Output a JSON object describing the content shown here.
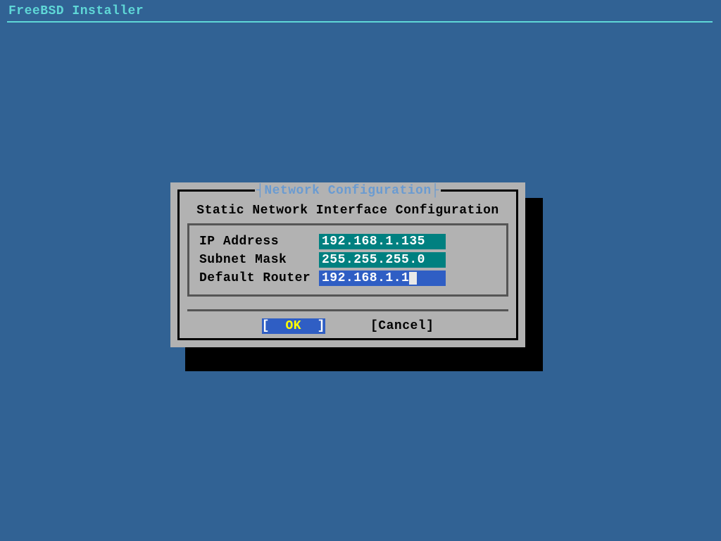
{
  "header": {
    "title": "FreeBSD Installer"
  },
  "dialog": {
    "title_open": "┤",
    "title_text": "Network Configuration",
    "title_close": "├",
    "subtitle": "Static Network Interface Configuration",
    "fields": [
      {
        "label": "IP Address",
        "value": "192.168.1.135",
        "style": "teal",
        "cursor": false
      },
      {
        "label": "Subnet Mask",
        "value": "255.255.255.0",
        "style": "teal",
        "cursor": false
      },
      {
        "label": "Default Router",
        "value": "192.168.1.1",
        "style": "blue",
        "cursor": true
      }
    ],
    "buttons": {
      "ok": {
        "open": "[  ",
        "label": "OK",
        "close": "  ]"
      },
      "cancel": {
        "open": "[",
        "label": "Cancel",
        "close": "]"
      }
    }
  }
}
